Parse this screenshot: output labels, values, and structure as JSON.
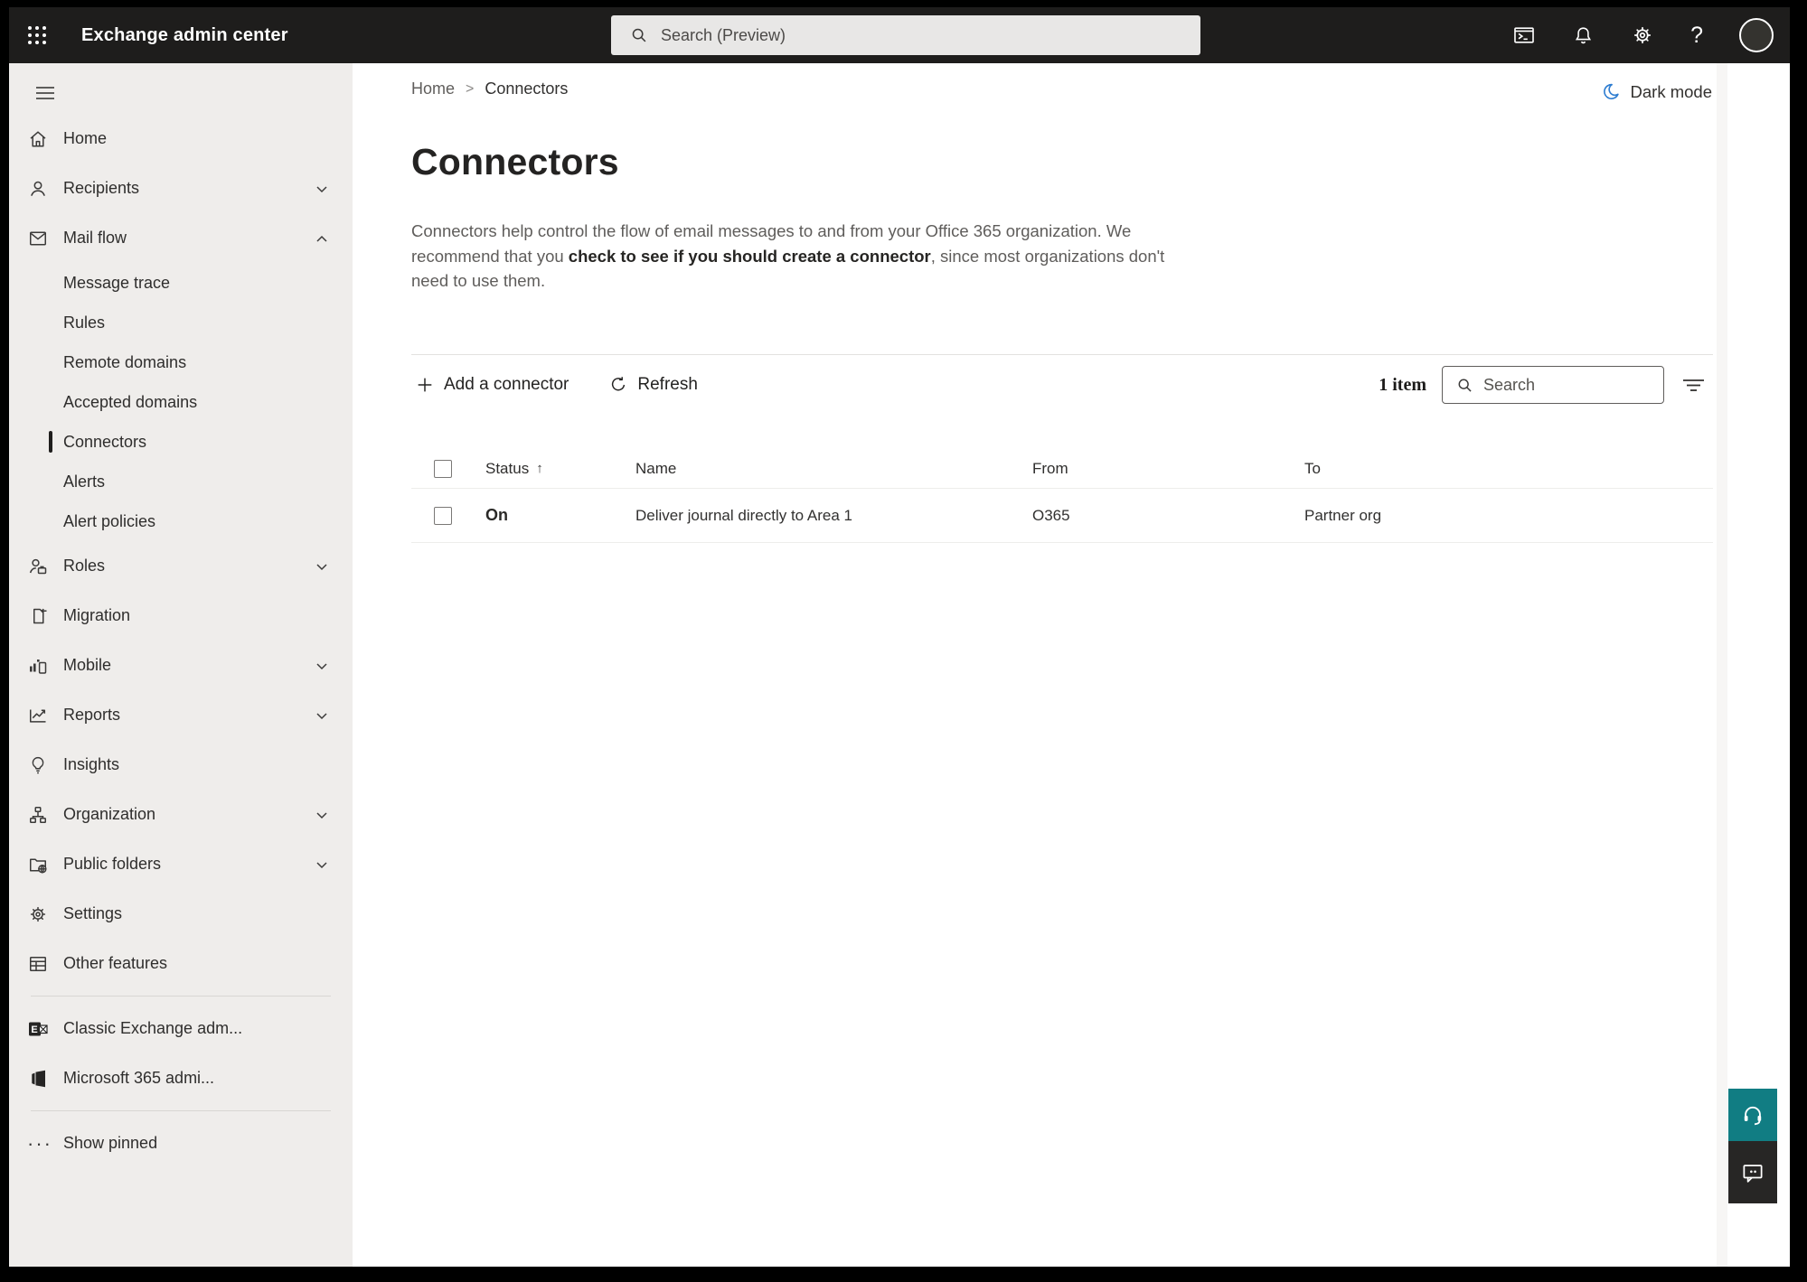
{
  "topbar": {
    "title": "Exchange admin center",
    "search_placeholder": "Search (Preview)"
  },
  "sidebar": {
    "home": "Home",
    "recipients": "Recipients",
    "mail_flow": "Mail flow",
    "mailflow": [
      "Message trace",
      "Rules",
      "Remote domains",
      "Accepted domains",
      "Connectors",
      "Alerts",
      "Alert policies"
    ],
    "roles": "Roles",
    "migration": "Migration",
    "mobile": "Mobile",
    "reports": "Reports",
    "insights": "Insights",
    "organization": "Organization",
    "public_folders": "Public folders",
    "settings": "Settings",
    "other_features": "Other features",
    "classic_exchange": "Classic Exchange adm...",
    "m365_admin": "Microsoft 365 admi...",
    "show_pinned": "Show pinned"
  },
  "breadcrumb": {
    "home": "Home",
    "separator": ">",
    "current": "Connectors"
  },
  "page": {
    "title": "Connectors",
    "dark_mode": "Dark mode"
  },
  "description": {
    "part1": "Connectors help control the flow of email messages to and from your Office 365 organization. We recommend that you ",
    "link": "check to see if you should create a connector",
    "part2": ", since most organizations don't need to use them."
  },
  "toolbar": {
    "add": "Add a connector",
    "refresh": "Refresh",
    "count": "1 item",
    "search_placeholder": "Search"
  },
  "table": {
    "columns": [
      "Status",
      "Name",
      "From",
      "To"
    ],
    "sort_indicator": "↑",
    "rows": [
      {
        "status": "On",
        "name": "Deliver journal directly to Area 1",
        "from": "O365",
        "to": "Partner org"
      }
    ]
  },
  "icons": {
    "app_launcher": "3x3-dot-grid",
    "topbar_search": "magnifier",
    "powershell": "terminal-window",
    "notifications": "bell",
    "settings": "gear",
    "help": "?",
    "dark_mode": "crescent-moon",
    "add": "+",
    "refresh": "circular-arrow",
    "filter": "decreasing-lines",
    "show_pinned": "...",
    "support": "headset",
    "feedback": "speech-bubble"
  },
  "colors": {
    "topbar_bg": "#1e1d1c",
    "sidebar_bg": "#efedeb",
    "help_button": "#117d83",
    "feedback_button": "#272625",
    "dark_mode_icon": "#2e7dd1",
    "text_primary": "#323130",
    "text_secondary": "#605e5c"
  }
}
